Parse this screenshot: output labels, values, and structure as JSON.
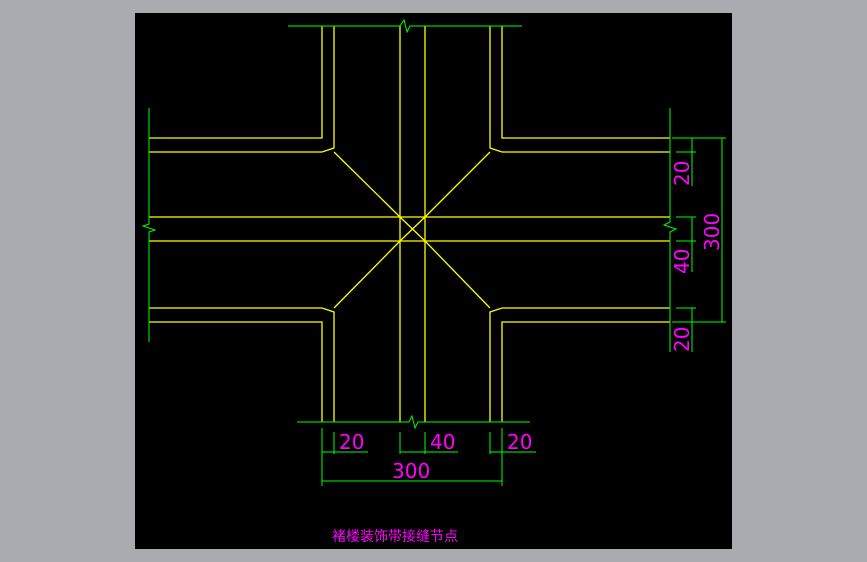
{
  "colors": {
    "background": "#a9abb0",
    "canvas": "#000000",
    "outline": "#ffff00",
    "dimension_line": "#00ff00",
    "dimension_text": "#ff00ff"
  },
  "dimensions": {
    "bottom_left": "20",
    "bottom_middle": "40",
    "bottom_right": "20",
    "bottom_total": "300",
    "right_top": "20",
    "right_middle": "40",
    "right_bottom": "20",
    "right_total": "300"
  },
  "caption": "褚楼装饰带接缝节点"
}
